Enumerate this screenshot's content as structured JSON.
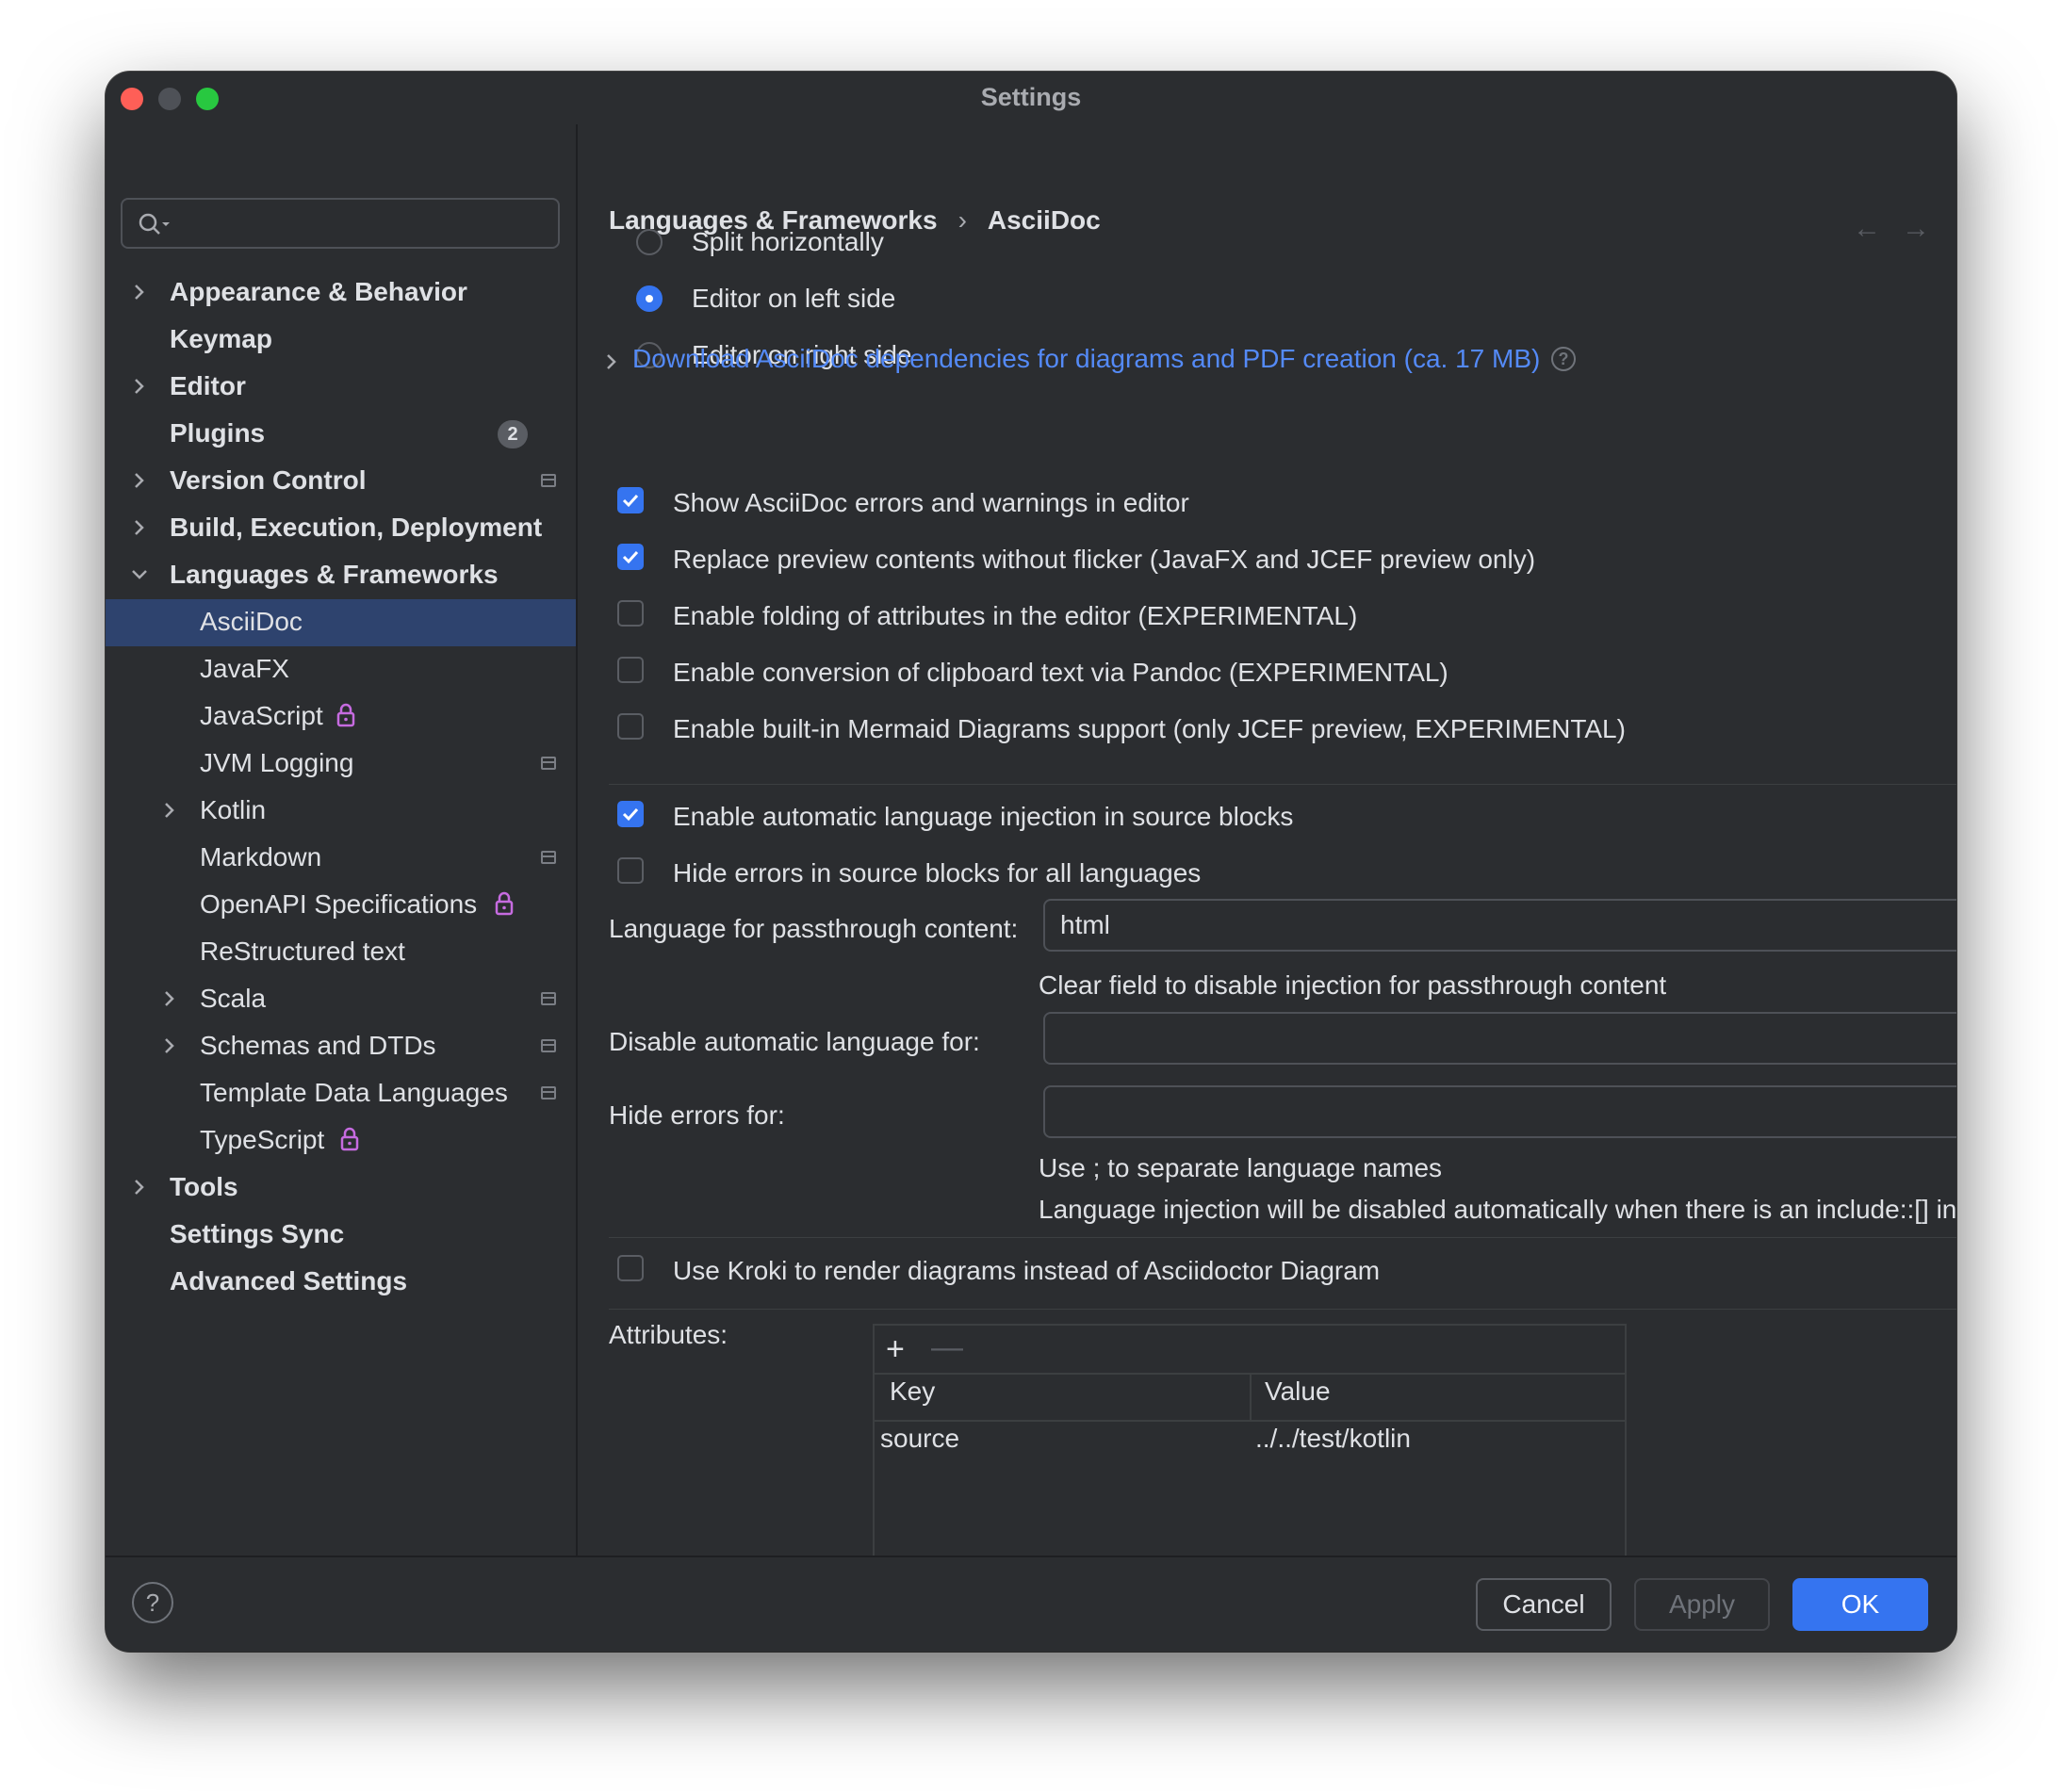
{
  "window": {
    "title": "Settings"
  },
  "sidebar": {
    "search": {
      "placeholder": "",
      "value": ""
    },
    "items": [
      {
        "label": "Appearance & Behavior",
        "expandable": true,
        "expanded": false,
        "level": 0
      },
      {
        "label": "Keymap",
        "level": 0
      },
      {
        "label": "Editor",
        "expandable": true,
        "expanded": false,
        "level": 0
      },
      {
        "label": "Plugins",
        "level": 0,
        "badge": "2"
      },
      {
        "label": "Version Control",
        "expandable": true,
        "expanded": false,
        "level": 0,
        "icon": "project-level-icon"
      },
      {
        "label": "Build, Execution, Deployment",
        "expandable": true,
        "expanded": false,
        "level": 0
      },
      {
        "label": "Languages & Frameworks",
        "expandable": true,
        "expanded": true,
        "level": 0
      },
      {
        "label": "AsciiDoc",
        "level": 1,
        "selected": true
      },
      {
        "label": "JavaFX",
        "level": 1
      },
      {
        "label": "JavaScript",
        "level": 1,
        "icon": "lock-icon"
      },
      {
        "label": "JVM Logging",
        "level": 1,
        "icon": "project-level-icon"
      },
      {
        "label": "Kotlin",
        "expandable": true,
        "expanded": false,
        "level": 1
      },
      {
        "label": "Markdown",
        "level": 1,
        "icon": "project-level-icon"
      },
      {
        "label": "OpenAPI Specifications",
        "level": 1,
        "icon": "lock-icon"
      },
      {
        "label": "ReStructured text",
        "level": 1
      },
      {
        "label": "Scala",
        "expandable": true,
        "expanded": false,
        "level": 1,
        "icon": "project-level-icon"
      },
      {
        "label": "Schemas and DTDs",
        "expandable": true,
        "expanded": false,
        "level": 1,
        "icon": "project-level-icon"
      },
      {
        "label": "Template Data Languages",
        "level": 1,
        "icon": "project-level-icon"
      },
      {
        "label": "TypeScript",
        "level": 1,
        "icon": "lock-icon"
      },
      {
        "label": "Tools",
        "expandable": true,
        "expanded": false,
        "level": 0
      },
      {
        "label": "Settings Sync",
        "level": 0
      },
      {
        "label": "Advanced Settings",
        "level": 0
      }
    ]
  },
  "breadcrumb": {
    "parent": "Languages & Frameworks",
    "separator": "›",
    "current": "AsciiDoc"
  },
  "nav_arrows": {
    "back": "←",
    "forward": "→"
  },
  "layout_radios": [
    {
      "label": "Split horizontally",
      "selected": false
    },
    {
      "label": "Editor on left side",
      "selected": true
    },
    {
      "label": "Editor on right side",
      "selected": false
    }
  ],
  "download_link": "Download AsciiDoc dependencies for diagrams and PDF creation (ca. 17 MB)",
  "options_group1": [
    {
      "label": "Show AsciiDoc errors and warnings in editor",
      "checked": true
    },
    {
      "label": "Replace preview contents without flicker (JavaFX and JCEF preview only)",
      "checked": true
    },
    {
      "label": "Enable folding of attributes in the editor (EXPERIMENTAL)",
      "checked": false
    },
    {
      "label": "Enable conversion of clipboard text via Pandoc (EXPERIMENTAL)",
      "checked": false
    },
    {
      "label": "Enable built-in Mermaid Diagrams support (only JCEF preview, EXPERIMENTAL)",
      "checked": false
    }
  ],
  "options_group2": [
    {
      "label": "Enable automatic language injection in source blocks",
      "checked": true
    },
    {
      "label": "Hide errors in source blocks for all languages",
      "checked": false
    }
  ],
  "passthrough": {
    "label": "Language for passthrough content:",
    "value": "html",
    "hint": "Clear field to disable injection for passthrough content"
  },
  "disable_auto": {
    "label": "Disable automatic language for:",
    "value": ""
  },
  "hide_errors": {
    "label": "Hide errors for:",
    "value": ""
  },
  "hints": {
    "separator": "Use ; to separate language names",
    "include": "Language injection will be disabled automatically when there is an include::[] in"
  },
  "kroki": {
    "label": "Use Kroki to render diagrams instead of Asciidoctor Diagram",
    "checked": false
  },
  "attributes": {
    "label": "Attributes:",
    "add": "+",
    "remove": "—",
    "columns": [
      "Key",
      "Value"
    ],
    "rows": [
      {
        "key": "source",
        "value": "../../test/kotlin"
      }
    ]
  },
  "footer": {
    "help": "?",
    "cancel": "Cancel",
    "apply": "Apply",
    "ok": "OK"
  },
  "colors": {
    "accent": "#3574f0",
    "link": "#548af7",
    "selection": "#2e436e",
    "background": "#2b2d30",
    "lock": "#c66be0"
  }
}
